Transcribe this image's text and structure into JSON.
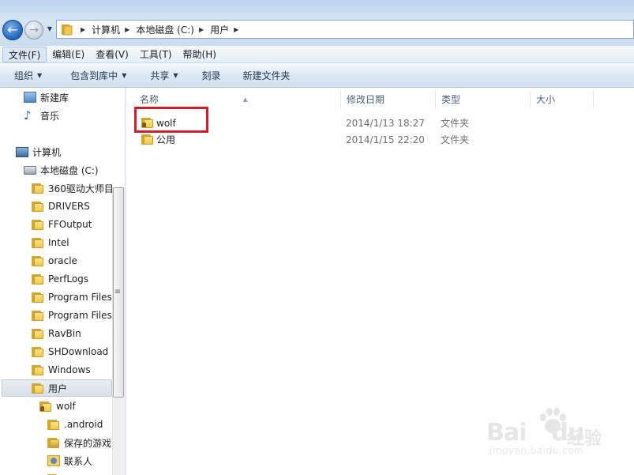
{
  "address": {
    "crumbs": [
      "计算机",
      "本地磁盘 (C:)",
      "用户"
    ]
  },
  "menu": [
    "文件(F)",
    "编辑(E)",
    "查看(V)",
    "工具(T)",
    "帮助(H)"
  ],
  "commands": [
    {
      "label": "组织",
      "dropdown": true
    },
    {
      "label": "包含到库中",
      "dropdown": true
    },
    {
      "label": "共享",
      "dropdown": true
    },
    {
      "label": "刻录",
      "dropdown": false
    },
    {
      "label": "新建文件夹",
      "dropdown": false
    }
  ],
  "nav": {
    "items": [
      {
        "label": "新建库",
        "icon": "library-icon"
      },
      {
        "label": "音乐",
        "icon": "music-icon"
      },
      {
        "label": "计算机",
        "icon": "computer-icon"
      },
      {
        "label": "本地磁盘 (C:)",
        "icon": "drive-icon"
      },
      {
        "label": "360驱动大师目",
        "icon": "folder-icon"
      },
      {
        "label": "DRIVERS",
        "icon": "folder-icon"
      },
      {
        "label": "FFOutput",
        "icon": "folder-icon"
      },
      {
        "label": "Intel",
        "icon": "folder-icon"
      },
      {
        "label": "oracle",
        "icon": "folder-icon"
      },
      {
        "label": "PerfLogs",
        "icon": "folder-icon"
      },
      {
        "label": "Program Files",
        "icon": "folder-icon"
      },
      {
        "label": "Program Files",
        "icon": "folder-icon"
      },
      {
        "label": "RavBin",
        "icon": "folder-icon"
      },
      {
        "label": "SHDownload",
        "icon": "folder-icon"
      },
      {
        "label": "Windows",
        "icon": "folder-icon"
      },
      {
        "label": "用户",
        "icon": "folder-icon",
        "selected": true
      },
      {
        "label": "wolf",
        "icon": "user-folder-icon"
      },
      {
        "label": ".android",
        "icon": "folder-icon"
      },
      {
        "label": "保存的游戏",
        "icon": "saved-games-icon"
      },
      {
        "label": "联系人",
        "icon": "contacts-icon"
      }
    ]
  },
  "columns": [
    "名称",
    "修改日期",
    "类型",
    "大小"
  ],
  "files": [
    {
      "name": "wolf",
      "date": "2014/1/13 18:27",
      "type": "文件夹",
      "icon": "user-folder-icon"
    },
    {
      "name": "公用",
      "date": "2014/1/15 22:20",
      "type": "文件夹",
      "icon": "folder-icon"
    }
  ],
  "watermark": {
    "brand": "Bai",
    "brand2": "du",
    "text": "经验",
    "url": "jingyan.baidu.com"
  },
  "colors": {
    "highlight": "#cc1f2a",
    "accent": "#2a6fc5"
  }
}
